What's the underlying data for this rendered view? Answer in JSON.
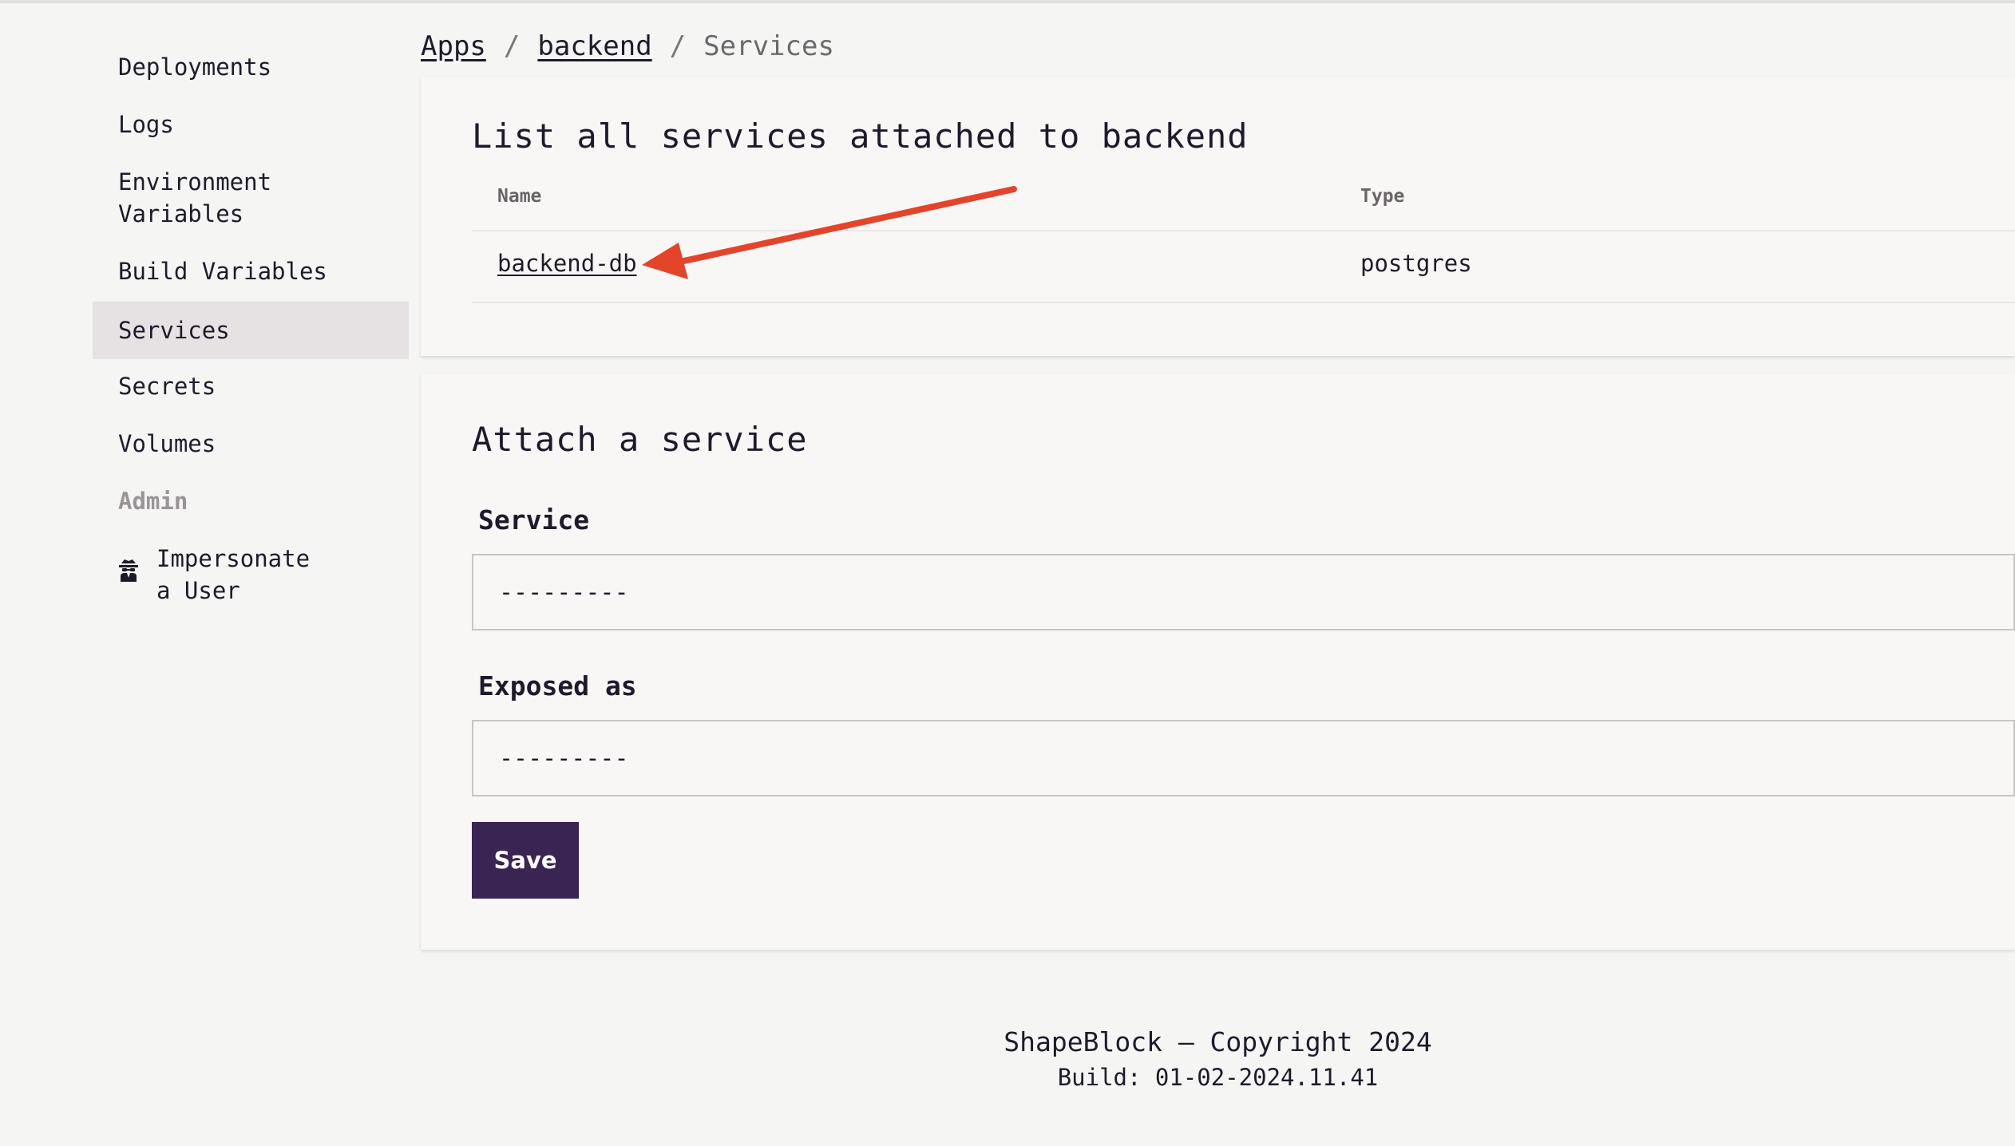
{
  "sidebar": {
    "items": [
      {
        "label": "Deployments"
      },
      {
        "label": "Logs"
      },
      {
        "label": "Environment Variables"
      },
      {
        "label": "Build Variables"
      },
      {
        "label": "Services",
        "active": true
      },
      {
        "label": "Secrets"
      },
      {
        "label": "Volumes"
      }
    ],
    "admin_section": "Admin",
    "impersonate": {
      "label": "Impersonate a User",
      "icon": "spy-icon"
    }
  },
  "breadcrumb": {
    "apps": "Apps",
    "app": "backend",
    "current": "Services",
    "separator": "/"
  },
  "services_card": {
    "title": "List all services attached to backend",
    "columns": [
      "Name",
      "Type"
    ],
    "rows": [
      {
        "name": "backend-db",
        "type": "postgres"
      }
    ]
  },
  "attach_card": {
    "title": "Attach a service",
    "service_label": "Service",
    "service_value": "---------",
    "exposed_label": "Exposed as",
    "exposed_value": "---------",
    "save_label": "Save"
  },
  "footer": {
    "copyright": "ShapeBlock — Copyright 2024",
    "build": "Build: 01-02-2024.11.41"
  },
  "colors": {
    "accent": "#3a2453",
    "annotation_arrow": "#e3452b",
    "active_nav_bg": "#e6e2e3"
  }
}
